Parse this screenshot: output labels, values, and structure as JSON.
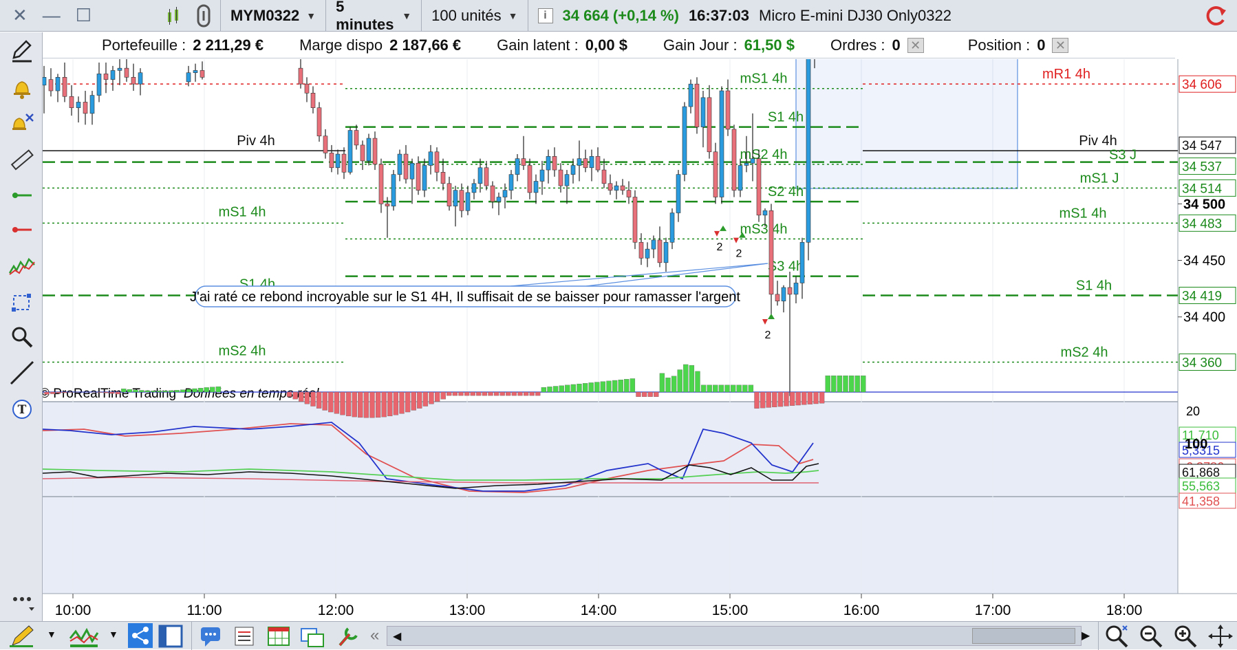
{
  "toolbar": {
    "symbol": "MYM0322",
    "timeframe": "5 minutes",
    "units": "100 unités",
    "price": "34 664 (+0,14 %)",
    "time": "16:37:03",
    "name": "Micro E-mini DJ30 Only0322",
    "info_icon": "info-icon"
  },
  "infobar": {
    "portefeuille_label": "Portefeuille :",
    "portefeuille_value": "2 211,29 €",
    "marge_label": "Marge dispo",
    "marge_value": "2 187,66 €",
    "gain_latent_label": "Gain latent :",
    "gain_latent_value": "0,00 $",
    "gain_jour_label": "Gain Jour :",
    "gain_jour_value": "61,50 $",
    "ordres_label": "Ordres :",
    "ordres_value": "0",
    "position_label": "Position :",
    "position_value": "0"
  },
  "colors": {
    "up": "#2a9bde",
    "down": "#e8707a",
    "level": "#1b8a1b",
    "resistance": "#e02020",
    "pivot": "#111111",
    "panel_bg": "#e8ecf7",
    "macd_pos": "#4cd64c",
    "macd_neg": "#e8656e",
    "signal_blue": "#2233cc",
    "signal_red": "#e05050",
    "stoch_green": "#55d055",
    "stoch_red": "#e06070"
  },
  "chart_data": [
    {
      "type": "candlestick",
      "ylim": [
        34325,
        34628
      ],
      "x_ticks": [
        "10:00",
        "11:00",
        "12:00",
        "13:00",
        "14:00",
        "15:00",
        "16:00",
        "17:00",
        "18:00"
      ],
      "y_ticks": [
        {
          "v": 34500,
          "label": "34 500",
          "bold": true
        },
        {
          "v": 34450,
          "label": "34 450"
        },
        {
          "v": 34400,
          "label": "34 400"
        }
      ],
      "y_markers": [
        {
          "v": 34606,
          "label": "34 606",
          "color": "#e02020"
        },
        {
          "v": 34547,
          "label": "34 547",
          "color": "#111111"
        },
        {
          "v": 34537,
          "label": "34 537",
          "color": "#1b8a1b"
        },
        {
          "v": 34514,
          "label": "34 514",
          "color": "#1b8a1b"
        },
        {
          "v": 34483,
          "label": "34 483",
          "color": "#1b8a1b"
        },
        {
          "v": 34419,
          "label": "34 419",
          "color": "#1b8a1b"
        },
        {
          "v": 34360,
          "label": "34 360",
          "color": "#1b8a1b"
        }
      ],
      "levels": [
        {
          "name": "mR1 4h",
          "v": 34606,
          "color": "#e02020"
        },
        {
          "name": "Piv 4h",
          "v": 34547,
          "color": "#111111"
        },
        {
          "name": "S3 J",
          "v": 34537,
          "color": "#1b8a1b"
        },
        {
          "name": "mS1 J",
          "v": 34514,
          "color": "#1b8a1b"
        },
        {
          "name": "mS1 4h",
          "v": 34483,
          "color": "#1b8a1b"
        },
        {
          "name": "S1 4h",
          "v": 34419,
          "color": "#1b8a1b"
        },
        {
          "name": "mS2 4h",
          "v": 34360,
          "color": "#1b8a1b"
        },
        {
          "name": "mS1 4h",
          "v": 34602,
          "color": "#1b8a1b"
        },
        {
          "name": "S1 4h",
          "v": 34568,
          "color": "#1b8a1b"
        },
        {
          "name": "mS2 4h",
          "v": 34535,
          "color": "#1b8a1b"
        },
        {
          "name": "S2 4h",
          "v": 34502,
          "color": "#1b8a1b"
        },
        {
          "name": "mS3 4h",
          "v": 34469,
          "color": "#1b8a1b"
        },
        {
          "name": "S3 4h",
          "v": 34436,
          "color": "#1b8a1b"
        }
      ],
      "annotation": "J'ai raté ce rebond incroyable sur le S1 4H, Il suffisait de se baisser pour ramasser l'argent",
      "signal_counts": [
        "2",
        "2",
        "2"
      ],
      "footer_copyright": "© ProRealTime Trading",
      "footer_data": "Données en temps réel"
    },
    {
      "type": "bar",
      "name": "MACD",
      "y_ticks": [
        "20"
      ],
      "markers": [
        {
          "label": "11,710",
          "color": "#3bbd3b"
        },
        {
          "label": "5,3315",
          "color": "#2233cc"
        },
        {
          "label": "-6,3786",
          "color": "#e05050"
        }
      ]
    },
    {
      "type": "line",
      "name": "Stochastic",
      "y_ticks": [
        "100"
      ],
      "markers": [
        {
          "label": "61,868",
          "color": "#111111"
        },
        {
          "label": "55,563",
          "color": "#3bbd3b"
        },
        {
          "label": "41,358",
          "color": "#e05050"
        }
      ]
    }
  ],
  "lefttools": [
    "pencil-icon",
    "alert-bell-icon",
    "alert-remove-icon",
    "ruler-icon",
    "green-line-icon",
    "red-line-icon",
    "indicator-icon",
    "rectangle-icon",
    "zoom-icon",
    "trendline-icon",
    "text-icon",
    "more-icon"
  ],
  "bottomtools": [
    "draw-icon",
    "indicators-icon",
    "share-icon",
    "layout-icon",
    "comment-icon",
    "list-icon",
    "table-icon",
    "window-icon",
    "settings-icon",
    "scroll-left-icon",
    "scroll-right-icon",
    "zoom-fit-icon",
    "zoom-out-icon",
    "zoom-in-icon",
    "move-icon"
  ]
}
